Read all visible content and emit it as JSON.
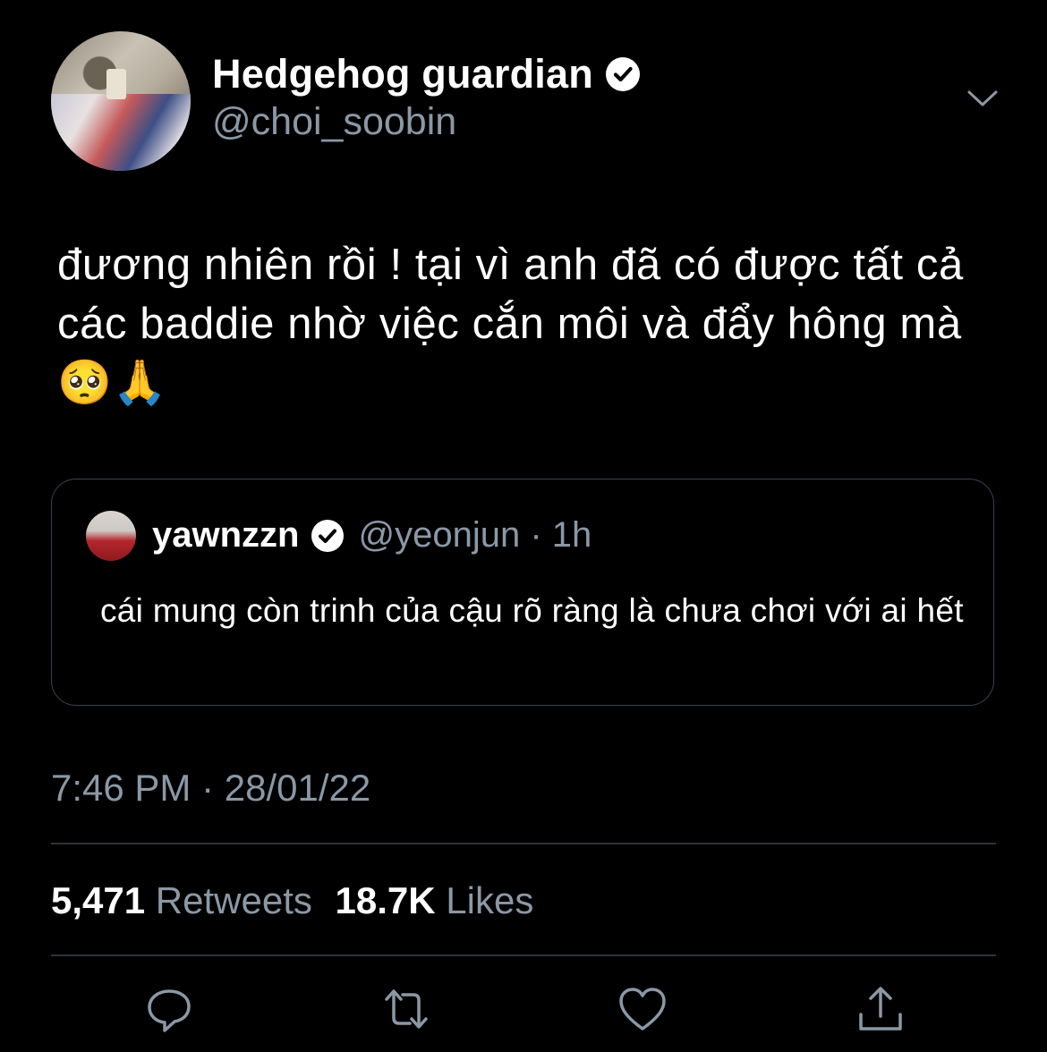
{
  "author": {
    "display_name": "Hedgehog guardian",
    "handle": "@choi_soobin",
    "verified": true
  },
  "tweet": {
    "text": "đương nhiên rồi ! tại vì anh đã có được tất cả các baddie nhờ việc cắn môi và đẩy hông mà 🥺🙏",
    "timestamp": "7:46 PM · 28/01/22"
  },
  "quoted_tweet": {
    "display_name": "yawnzzn",
    "handle_time": "@yeonjun · 1h",
    "verified": true,
    "text": "cái mung còn trinh của cậu rõ ràng là chưa chơi với ai hết"
  },
  "stats": {
    "retweets_count": "5,471",
    "retweets_label": "Retweets",
    "likes_count": "18.7K",
    "likes_label": "Likes"
  },
  "icons": {
    "verified": "verified-badge-icon",
    "more": "chevron-down-icon",
    "reply": "reply-icon",
    "retweet": "retweet-icon",
    "like": "heart-icon",
    "share": "share-icon"
  },
  "colors": {
    "background": "#000000",
    "text": "#ffffff",
    "secondary": "#8b98a5",
    "border": "#38444d"
  }
}
